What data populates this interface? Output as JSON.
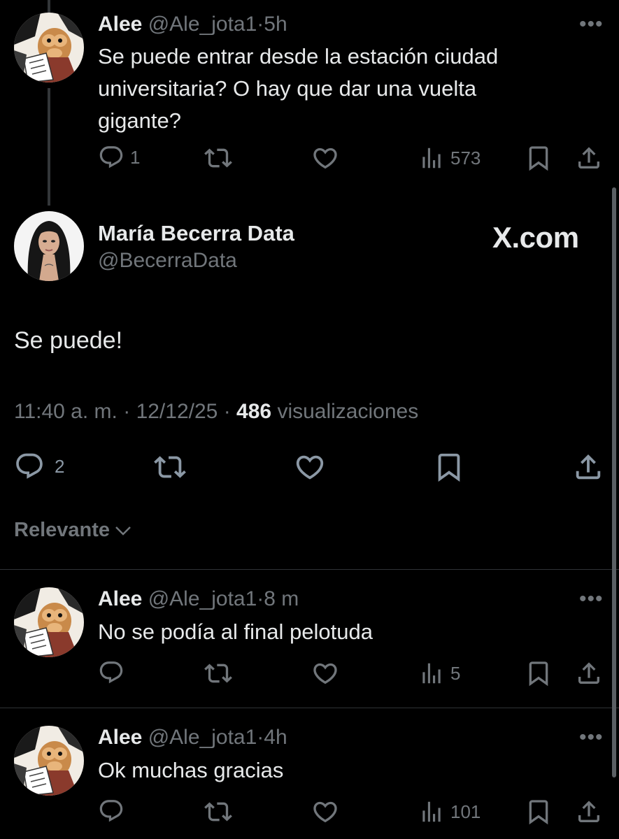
{
  "parent_tweet": {
    "name": "Alee",
    "handle": "@Ale_jota1",
    "sep": "·",
    "time": "5h",
    "text_line1": "Se puede entrar desde la estación ciudad",
    "text_line2": "universitaria? O hay que dar una vuelta",
    "text_line3": "gigante?",
    "replies": "1",
    "views": "573"
  },
  "main_tweet": {
    "name": "María Becerra Data",
    "handle": "@BecerraData",
    "watermark": "X.com",
    "text": "Se puede!",
    "time": "11:40 a. m.",
    "date": "12/12/25",
    "views_count": "486",
    "views_label": "visualizaciones",
    "replies": "2"
  },
  "sort": {
    "label": "Relevante"
  },
  "replies": [
    {
      "name": "Alee",
      "handle": "@Ale_jota1",
      "time": "8 m",
      "text": "No se podía al final pelotuda",
      "views": "5"
    },
    {
      "name": "Alee",
      "handle": "@Ale_jota1",
      "time": "4h",
      "text": "Ok muchas gracias",
      "views": "101"
    }
  ],
  "colors": {
    "background": "#000000",
    "text": "#e7e9ea",
    "muted": "#71767b",
    "divider": "#2f3336"
  }
}
